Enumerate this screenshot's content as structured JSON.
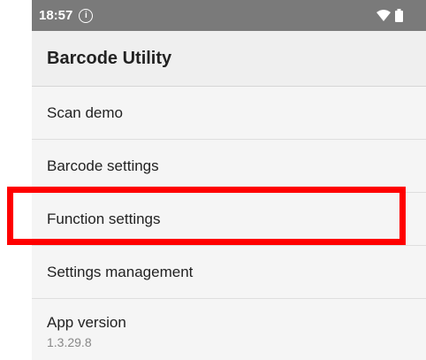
{
  "status_bar": {
    "time": "18:57",
    "info_icon": "info-circle-icon",
    "wifi_icon": "wifi-icon",
    "battery_icon": "battery-icon"
  },
  "app_bar": {
    "title": "Barcode Utility"
  },
  "menu": {
    "items": [
      {
        "label": "Scan demo"
      },
      {
        "label": "Barcode settings"
      },
      {
        "label": "Function settings"
      },
      {
        "label": "Settings management"
      },
      {
        "label": "App version",
        "sub": "1.3.29.8"
      }
    ]
  },
  "colors": {
    "highlight": "#ff0000",
    "status_bar": "#7a7a7a"
  }
}
